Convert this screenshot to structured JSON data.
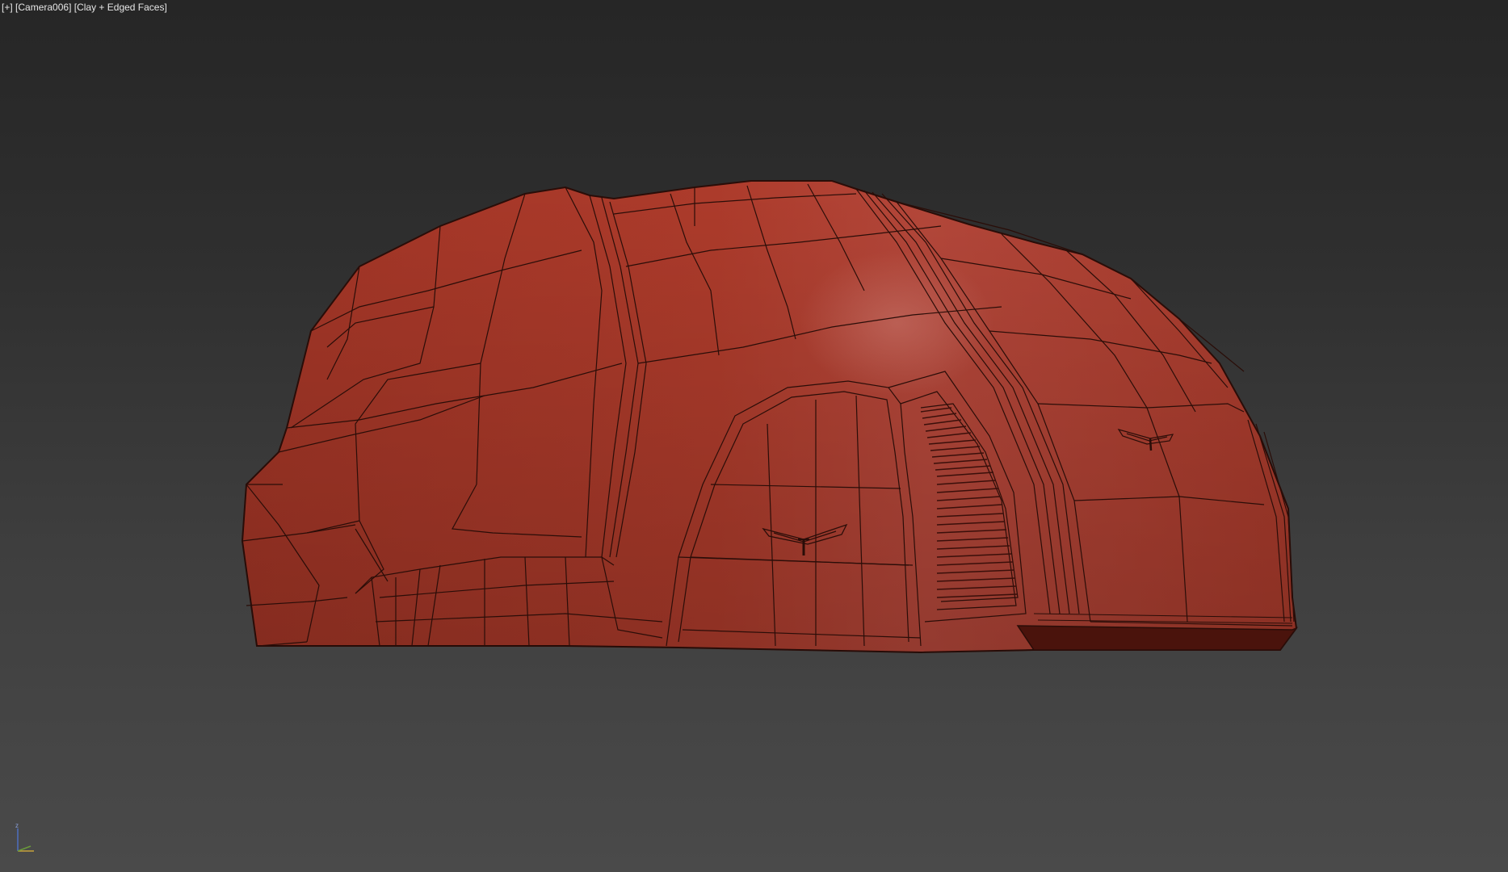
{
  "viewport": {
    "menu_label": "[+]",
    "camera_label": "[Camera006]",
    "shading_label": "[Clay + Edged Faces]"
  },
  "colors": {
    "background_top": "#262626",
    "background_bottom": "#4a4a4a",
    "model_fill": "#a8392a",
    "model_edges": "#2a0d08",
    "label_text": "#e6e6e6"
  },
  "gizmo": {
    "axis_z": "z",
    "icon": "axis-tripod-icon"
  }
}
